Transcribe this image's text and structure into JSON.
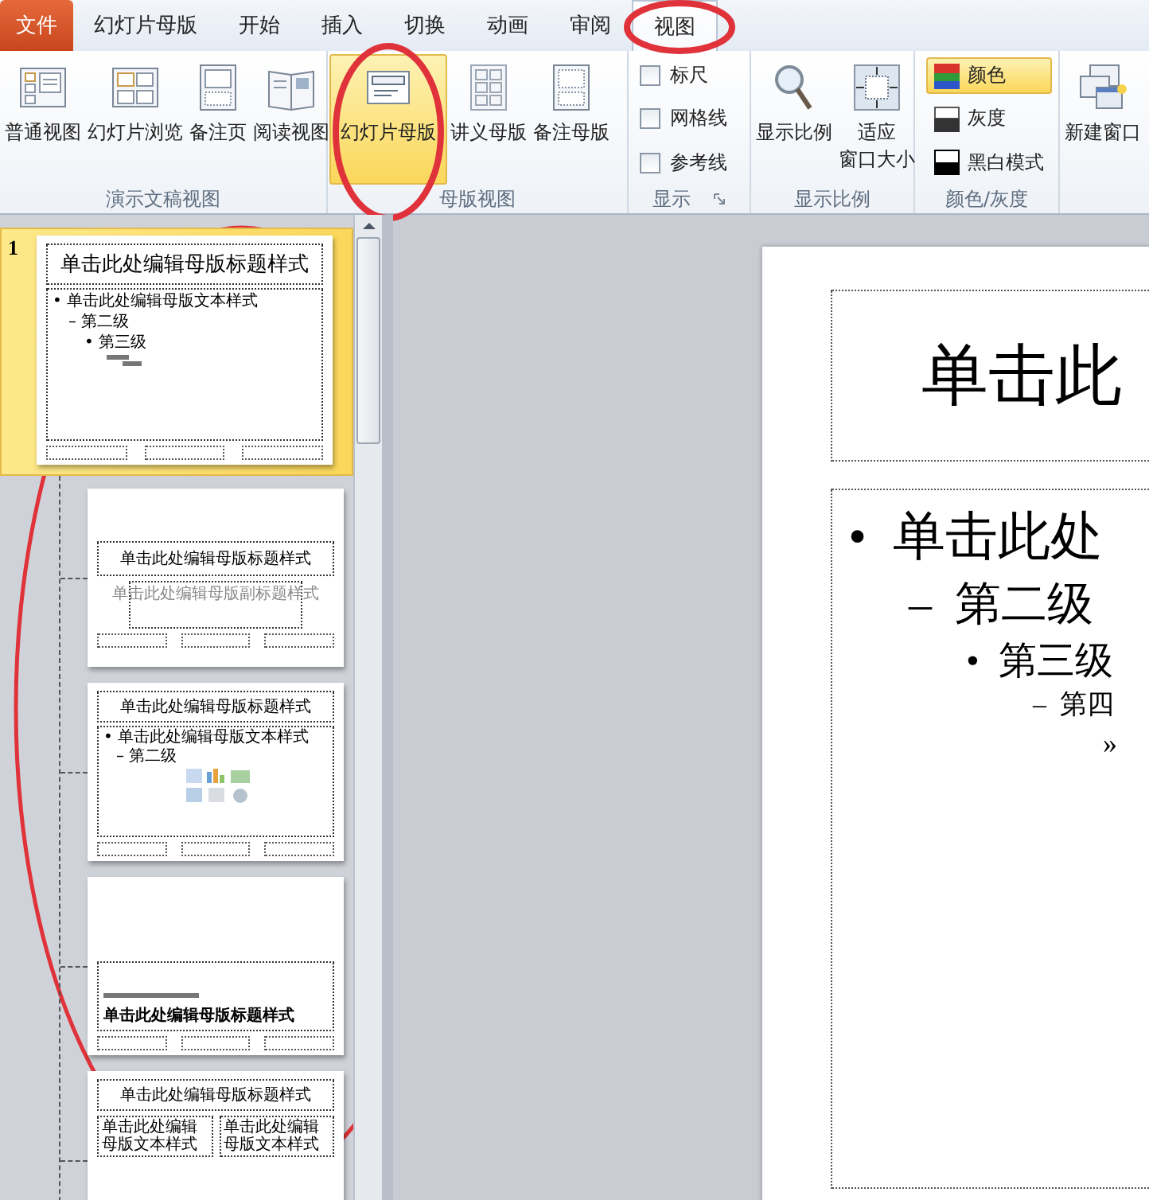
{
  "tabs": [
    {
      "label": "文件",
      "kind": "file",
      "selected": false
    },
    {
      "label": "幻灯片母版",
      "kind": "tab",
      "selected": false
    },
    {
      "label": "开始",
      "kind": "tab",
      "selected": false
    },
    {
      "label": "插入",
      "kind": "tab",
      "selected": false
    },
    {
      "label": "切换",
      "kind": "tab",
      "selected": false
    },
    {
      "label": "动画",
      "kind": "tab",
      "selected": false
    },
    {
      "label": "审阅",
      "kind": "tab",
      "selected": false
    },
    {
      "label": "视图",
      "kind": "tab",
      "selected": true
    }
  ],
  "ribbon": {
    "groups": [
      {
        "label": "演示文稿视图",
        "kind": "buttons",
        "buttons": [
          {
            "lines": [
              "普通视图"
            ],
            "selected": false
          },
          {
            "lines": [
              "幻灯片浏览"
            ],
            "selected": false
          },
          {
            "lines": [
              "备注页"
            ],
            "selected": false
          },
          {
            "lines": [
              "阅读视图"
            ],
            "selected": false
          }
        ]
      },
      {
        "label": "母版视图",
        "kind": "buttons",
        "buttons": [
          {
            "lines": [
              "幻灯片母版"
            ],
            "selected": true
          },
          {
            "lines": [
              "讲义母版"
            ],
            "selected": false
          },
          {
            "lines": [
              "备注母版"
            ],
            "selected": false
          }
        ]
      },
      {
        "label": "显示",
        "kind": "checks",
        "launcher": true,
        "items": [
          {
            "label": "标尺",
            "checked": false
          },
          {
            "label": "网格线",
            "checked": false
          },
          {
            "label": "参考线",
            "checked": false
          }
        ]
      },
      {
        "label": "显示比例",
        "kind": "buttons",
        "buttons": [
          {
            "lines": [
              "显示比例"
            ],
            "selected": false
          },
          {
            "lines": [
              "适应",
              "窗口大小"
            ],
            "selected": false
          }
        ]
      },
      {
        "label": "颜色/灰度",
        "kind": "colors",
        "items": [
          {
            "label": "颜色",
            "selected": true
          },
          {
            "label": "灰度",
            "selected": false
          },
          {
            "label": "黑白模式",
            "selected": false
          }
        ]
      },
      {
        "kind": "buttons",
        "buttons": [
          {
            "lines": [
              "新建窗口"
            ],
            "selected": false
          }
        ]
      }
    ]
  },
  "thumbnails": {
    "master": {
      "number": "1",
      "selected": true,
      "title": "单击此处编辑母版标题样式",
      "body": [
        {
          "bullet": "•",
          "text": "单击此处编辑母版文本样式",
          "children": [
            {
              "bullet": "–",
              "text": "第二级",
              "children": [
                {
                  "bullet": "•",
                  "text": "第三级"
                }
              ]
            }
          ]
        }
      ]
    },
    "layouts": [
      {
        "kind": "title",
        "selected": false,
        "title": "单击此处编辑母版标题样式",
        "subtitle": "单击此处编辑母版副标题样式"
      },
      {
        "kind": "content",
        "selected": false,
        "title": "单击此处编辑母版标题样式",
        "body": [
          {
            "bullet": "•",
            "text": "单击此处编辑母版文本样式",
            "children": [
              {
                "bullet": "–",
                "text": "第二级"
              }
            ]
          }
        ]
      },
      {
        "kind": "section",
        "selected": false,
        "title": "单击此处编辑母版标题样式"
      },
      {
        "kind": "two",
        "selected": false,
        "title": "单击此处编辑母版标题样式",
        "columns": [
          "单击此处编辑母版文本样式",
          "单击此处编辑母版文本样式"
        ]
      }
    ]
  },
  "slide": {
    "title": "单击此",
    "body": [
      {
        "bullet": "•",
        "text": "单击此处",
        "children": [
          {
            "bullet": "–",
            "text": "第二级",
            "children": [
              {
                "bullet": "•",
                "text": "第三级",
                "children": [
                  {
                    "bullet": "–",
                    "text": "第四",
                    "children": [
                      {
                        "bullet": "»"
                      }
                    ]
                  }
                ]
              }
            ]
          }
        ]
      }
    ]
  }
}
